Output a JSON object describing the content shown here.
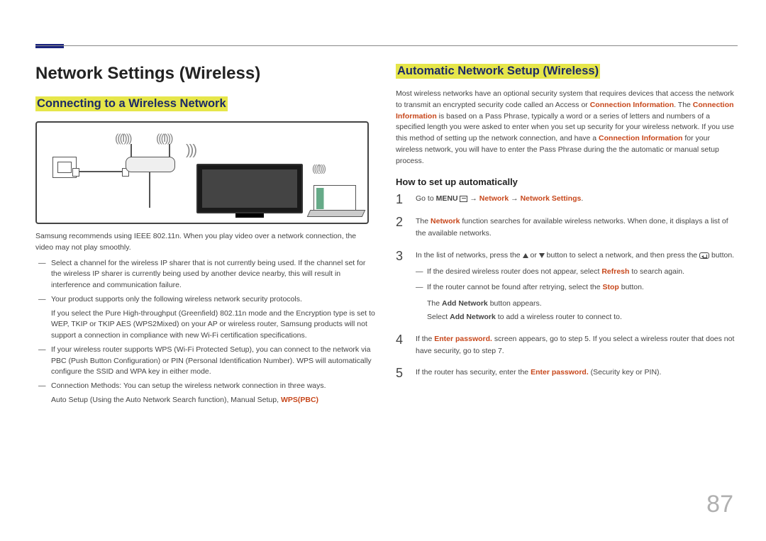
{
  "header": {
    "page_number": "87"
  },
  "left": {
    "title": "Network Settings (Wireless)",
    "section_heading": "Connecting to a Wireless Network",
    "recommendation": "Samsung recommends using IEEE 802.11n. When you play video over a network connection, the video may not play smoothly.",
    "bullets": [
      {
        "main": "Select a channel for the wireless IP sharer that is not currently being used. If the channel set for the wireless IP sharer is currently being used by another device nearby, this will result in interference and communication failure."
      },
      {
        "main": "Your product supports only the following wireless network security protocols.",
        "sub": "If you select the Pure High-throughput (Greenfield) 802.11n mode and the Encryption type is set to WEP, TKIP or TKIP AES (WPS2Mixed) on your AP or wireless router, Samsung products will not support a connection in compliance with new Wi-Fi certification specifications."
      },
      {
        "main": "If your wireless router supports WPS (Wi-Fi Protected Setup), you can connect to the network via PBC (Push Button Configuration) or PIN (Personal Identification Number). WPS will automatically configure the SSID and WPA key in either mode."
      },
      {
        "main": "Connection Methods: You can setup the wireless network connection in three ways.",
        "sub_pre": "Auto Setup (Using the Auto Network Search function), Manual Setup, ",
        "sub_orange": "WPS(PBC)"
      }
    ]
  },
  "right": {
    "section_heading": "Automatic Network Setup (Wireless)",
    "intro": {
      "t1": "Most wireless networks have an optional security system that requires devices that access the network to transmit an encrypted security code called an Access or ",
      "o1": "Connection Information",
      "t2": ". The ",
      "o2": "Connection Information",
      "t3": " is based on a Pass Phrase, typically a word or a series of letters and numbers of a specified length you were asked to enter when you set up security for your wireless network. If you use this method of setting up the network connection, and have a ",
      "o3": "Connection Information",
      "t4": " for your wireless network, you will have to enter the Pass Phrase during the the automatic or manual setup process."
    },
    "howto_heading": "How to set up automatically",
    "steps": [
      {
        "n": "1",
        "pre": "Go to ",
        "bold1": "MENU ",
        "arrow1": " → ",
        "o1": "Network",
        "arrow2": " → ",
        "o2": "Network Settings",
        "post": "."
      },
      {
        "n": "2",
        "pre": "The ",
        "o1": "Network",
        "post": " function searches for available wireless networks. When done, it displays a list of the available networks."
      },
      {
        "n": "3",
        "pre": "In the list of networks, press the ",
        "mid": " or ",
        "post": " button to select a network, and then press the ",
        "tail": " button.",
        "subs": [
          {
            "pre": "If the desired wireless router does not appear, select ",
            "o": "Refresh",
            "post": " to search again."
          },
          {
            "pre": "If the router cannot be found after retrying, select the ",
            "o": "Stop",
            "post": " button."
          },
          {
            "plain_pre": "The ",
            "bold": "Add Network",
            "plain_post": " button appears."
          },
          {
            "plain_pre": "Select ",
            "bold": "Add Network",
            "plain_post": " to add a wireless router to connect to."
          }
        ]
      },
      {
        "n": "4",
        "pre": "If the ",
        "o1": "Enter password.",
        "post": " screen appears, go to step 5. If you select a wireless router that does not have security, go to step 7."
      },
      {
        "n": "5",
        "pre": "If the router has security, enter the ",
        "o1": "Enter password.",
        "post": " (Security key or PIN)."
      }
    ]
  }
}
